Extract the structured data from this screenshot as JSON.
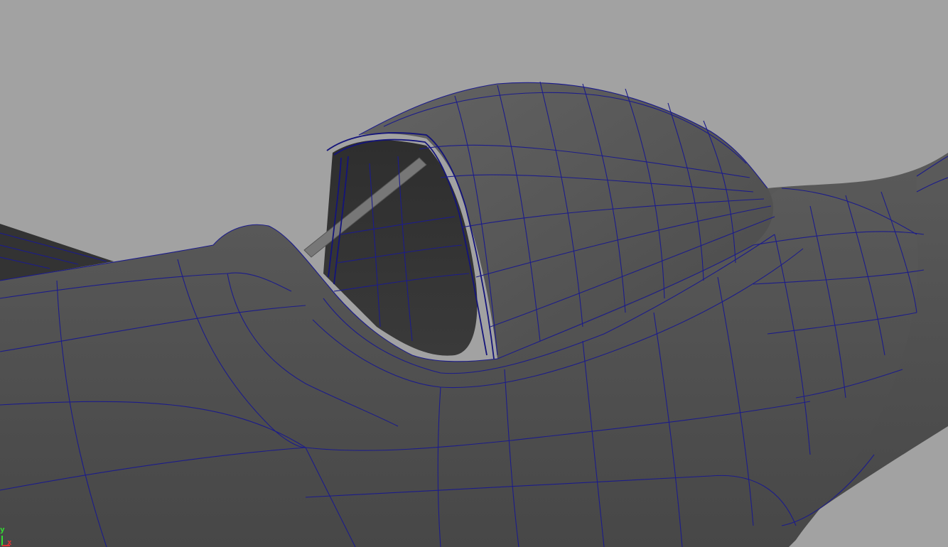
{
  "viewport": {
    "background_color": "#a2a2a2",
    "wireframe_color": "#1c1c8a",
    "shading_color": "#4f4f4f"
  },
  "axis_gizmo": {
    "y_label": "y",
    "x_label": "x",
    "y_color": "#33dd33",
    "x_color": "#dd3333"
  }
}
